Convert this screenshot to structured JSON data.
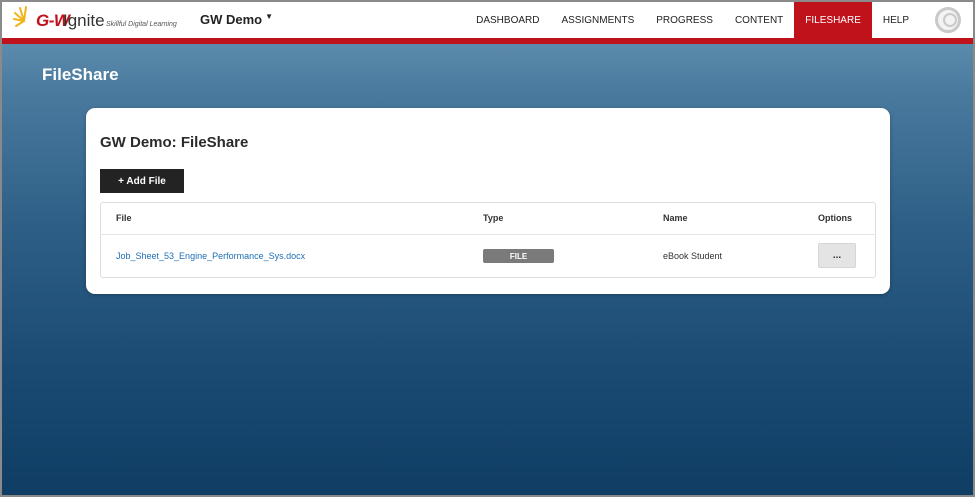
{
  "brand": {
    "logo_text": "G-W",
    "logo_product": "Ignite",
    "tagline": "Skillful Digital Learning"
  },
  "header": {
    "course_name": "GW Demo",
    "nav": [
      {
        "label": "DASHBOARD",
        "active": false
      },
      {
        "label": "ASSIGNMENTS",
        "active": false
      },
      {
        "label": "PROGRESS",
        "active": false
      },
      {
        "label": "CONTENT",
        "active": false
      },
      {
        "label": "FILESHARE",
        "active": true
      },
      {
        "label": "HELP",
        "active": false
      }
    ],
    "avatar_icon": "user-avatar-icon"
  },
  "page": {
    "heading": "FileShare",
    "card_title": "GW Demo: FileShare",
    "add_button": "+ Add File"
  },
  "table": {
    "columns": [
      "File",
      "Type",
      "Name",
      "Options"
    ],
    "rows": [
      {
        "file": "Job_Sheet_53_Engine_Performance_Sys.docx",
        "type": "FILE",
        "name": "eBook Student",
        "options": "..."
      }
    ]
  },
  "colors": {
    "accent": "#c0121b",
    "link": "#1f6fb5",
    "button_dark": "#232323",
    "badge": "#7a7a7a"
  }
}
